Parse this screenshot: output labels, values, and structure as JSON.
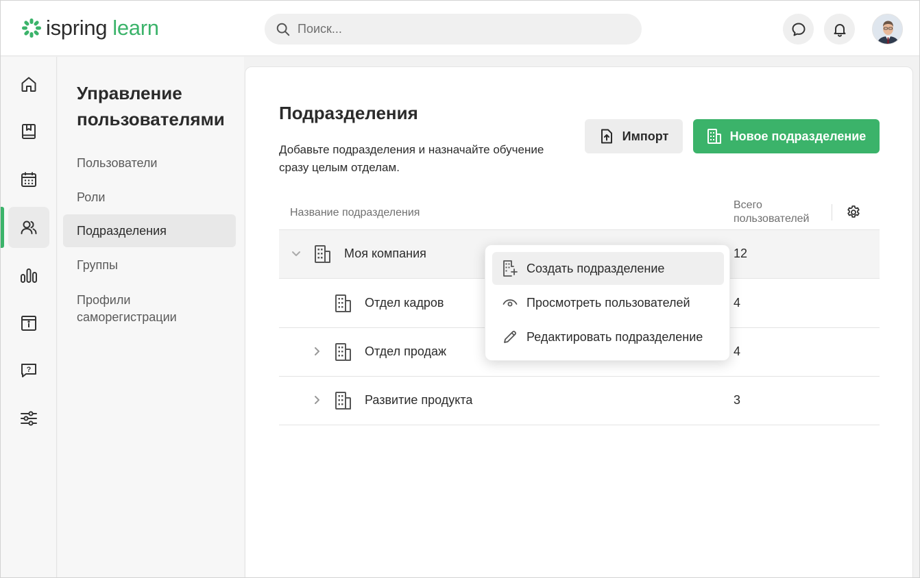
{
  "app": {
    "logo_left": "ispring",
    "logo_right": "learn",
    "brand_color": "#3bb36a"
  },
  "header": {
    "search_placeholder": "Поиск...",
    "icons": [
      "chat-icon",
      "bell-icon",
      "avatar"
    ]
  },
  "rail": {
    "items": [
      "home-icon",
      "book-icon",
      "calendar-icon",
      "users-icon",
      "chart-icon",
      "info-card-icon",
      "help-chat-icon",
      "settings-sliders-icon"
    ],
    "active": "users-icon"
  },
  "subnav": {
    "title": "Управление пользователями",
    "items": [
      {
        "label": "Пользователи"
      },
      {
        "label": "Роли"
      },
      {
        "label": "Подразделения"
      },
      {
        "label": "Группы"
      },
      {
        "label": "Профили саморегистрации"
      }
    ],
    "active_index": 2
  },
  "main": {
    "title": "Подразделения",
    "description": "Добавьте подразделения и назначайте обучение сразу целым отделам.",
    "import_label": "Импорт",
    "new_label": "Новое подразделение",
    "table": {
      "col_name": "Название подразделения",
      "col_total": "Всего пользователей",
      "rows": [
        {
          "name": "Моя компания",
          "count": "12",
          "expander": "expanded"
        },
        {
          "name": "Отдел кадров",
          "count": "4",
          "expander": "none"
        },
        {
          "name": "Отдел продаж",
          "count": "4",
          "expander": "collapsed"
        },
        {
          "name": "Развитие продукта",
          "count": "3",
          "expander": "collapsed"
        }
      ]
    }
  },
  "context_menu": {
    "items": [
      {
        "label": "Создать подразделение",
        "icon": "building-plus-icon"
      },
      {
        "label": "Просмотреть пользователей",
        "icon": "eye-icon"
      },
      {
        "label": "Редактировать подразделение",
        "icon": "pencil-icon"
      }
    ],
    "hover_index": 0
  }
}
